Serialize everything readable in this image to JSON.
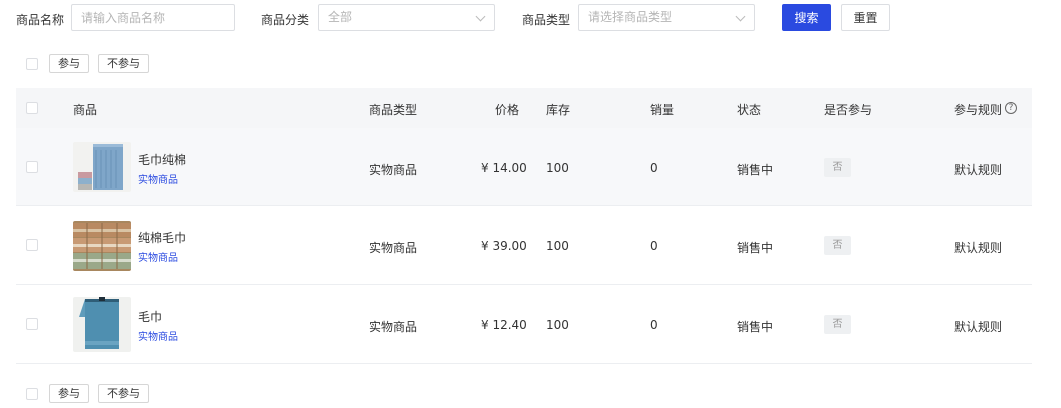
{
  "filters": {
    "name_label": "商品名称",
    "name_placeholder": "请输入商品名称",
    "category_label": "商品分类",
    "category_value": "全部",
    "type_label": "商品类型",
    "type_placeholder": "请选择商品类型",
    "search_label": "搜索",
    "reset_label": "重置"
  },
  "bulk_actions": {
    "join_label": "参与",
    "not_join_label": "不参与"
  },
  "table": {
    "headers": {
      "product": "商品",
      "type": "商品类型",
      "price": "价格",
      "stock": "库存",
      "sales": "销量",
      "status": "状态",
      "participate": "是否参与",
      "rule": "参与规则"
    },
    "help_icon": "question-circle-icon",
    "rows": [
      {
        "name": "毛巾纯棉",
        "type_tag": "实物商品",
        "type": "实物商品",
        "price": "¥ 14.00",
        "stock": "100",
        "sales": "0",
        "status": "销售中",
        "participate": "否",
        "rule": "默认规则"
      },
      {
        "name": "纯棉毛巾",
        "type_tag": "实物商品",
        "type": "实物商品",
        "price": "¥ 39.00",
        "stock": "100",
        "sales": "0",
        "status": "销售中",
        "participate": "否",
        "rule": "默认规则"
      },
      {
        "name": "毛巾",
        "type_tag": "实物商品",
        "type": "实物商品",
        "price": "¥ 12.40",
        "stock": "100",
        "sales": "0",
        "status": "销售中",
        "participate": "否",
        "rule": "默认规则"
      }
    ]
  },
  "colors": {
    "primary": "#2a4ae0",
    "header_bg": "#f5f6f8",
    "row_hover_bg": "#f7f8fa"
  }
}
